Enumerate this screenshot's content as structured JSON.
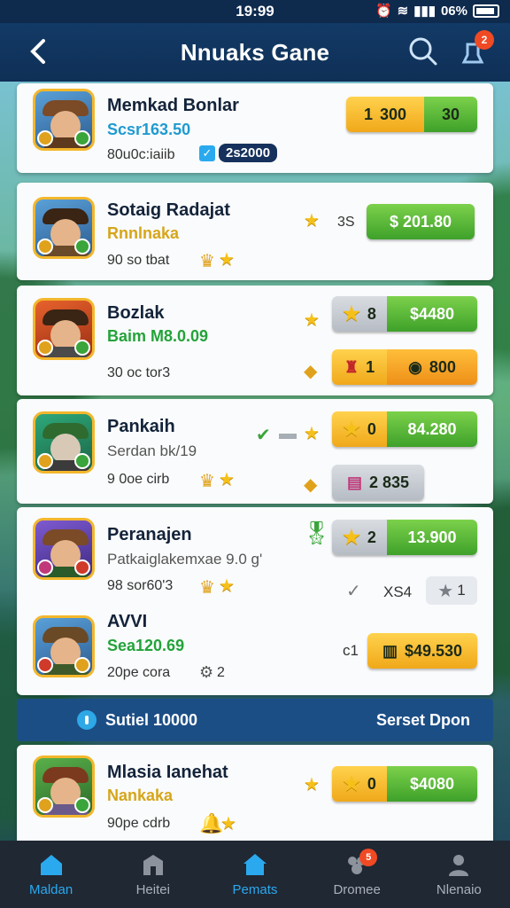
{
  "status": {
    "time": "19:99",
    "battery": "06%"
  },
  "header": {
    "title": "Nnuaks Gane",
    "notif_count": "2"
  },
  "cards": [
    {
      "name": "Memkad Bonlar",
      "sub": "Scsr163.50",
      "meta": "80u0c:iaiib",
      "tag": "2s2000",
      "pill_a": "300",
      "pill_a_prefix": "1",
      "pill_b": "30"
    },
    {
      "name": "Sotaig Radajat",
      "sub": "Rnnlnaka",
      "meta": "90 so tbat",
      "side_text": "3S",
      "pill_b": "$ 201.80"
    },
    {
      "name": "Bozlak",
      "sub": "Baim M8.0.09",
      "meta": "30 oc tor3",
      "pill_a": "8",
      "pill_b": "$4480",
      "pill_c_num": "1",
      "pill_c_val": "800"
    },
    {
      "name": "Pankaih",
      "sub": "Serdan bk/19",
      "meta": "9 0oe cirb",
      "pill_a": "0",
      "pill_b": "84.280",
      "pill_c_val": "2 835"
    },
    {
      "name": "Peranajen",
      "sub": "Patkaiglakemxae 9.0 g'",
      "meta": "98 sor60'3",
      "pill_a": "2",
      "pill_b": "13.900",
      "check_text": "XS4",
      "rate": "1"
    },
    {
      "name": "AVVI",
      "sub": "Sea120.69",
      "meta": "20pe cora",
      "meta2": "2",
      "side_text": "c1",
      "pill_b": "$49.530"
    },
    {
      "name": "Mlasia Ianehat",
      "sub": "Nankaka",
      "meta": "90pe cdrb",
      "pill_a": "0",
      "pill_b": "$4080"
    }
  ],
  "banner": {
    "left": "Sutiel 10000",
    "right": "Serset Dpon"
  },
  "nav": [
    {
      "label": "Maldan",
      "icon": "home-icon"
    },
    {
      "label": "Heitei",
      "icon": "shop-icon"
    },
    {
      "label": "Pemats",
      "icon": "house-icon"
    },
    {
      "label": "Dromee",
      "icon": "group-icon",
      "badge": "5"
    },
    {
      "label": "Nlenaio",
      "icon": "profile-icon"
    }
  ],
  "colors": {
    "header": "#0f2f56",
    "gold": "#f0a81a",
    "green": "#3ea12a",
    "accent": "#2aa9ef"
  }
}
